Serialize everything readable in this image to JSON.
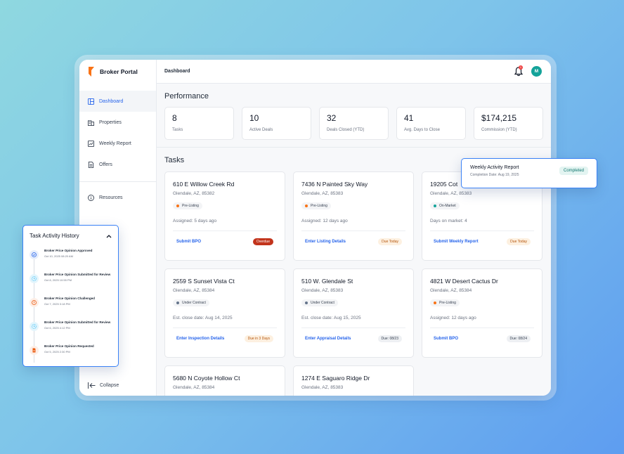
{
  "app": {
    "brand": "Broker Portal",
    "breadcrumb": "Dashboard",
    "notification_count": "1",
    "avatar_initial": "M"
  },
  "sidebar": {
    "items": [
      {
        "label": "Dashboard",
        "icon": "layout-icon"
      },
      {
        "label": "Properties",
        "icon": "building-icon"
      },
      {
        "label": "Weekly Report",
        "icon": "chart-icon"
      },
      {
        "label": "Offers",
        "icon": "document-icon"
      }
    ],
    "resources": "Resources",
    "collapse": "Collapse"
  },
  "performance": {
    "title": "Performance",
    "stats": [
      {
        "value": "8",
        "label": "Tasks"
      },
      {
        "value": "10",
        "label": "Active Deals"
      },
      {
        "value": "32",
        "label": "Deals Closed (YTD)"
      },
      {
        "value": "41",
        "label": "Avg. Days to Close"
      },
      {
        "value": "$174,215",
        "label": "Commission (YTD)"
      }
    ]
  },
  "tasks": {
    "title": "Tasks",
    "cards": [
      {
        "title": "610 E Willow Creek Rd",
        "address": "Glendale, AZ, 85382",
        "status": "Pre-Listing",
        "status_color": "#f97316",
        "meta": "Assigned: 5 days ago",
        "action": "Submit BPO",
        "badge": "Overdue",
        "badge_type": "overdue"
      },
      {
        "title": "7436 N Painted Sky Way",
        "address": "Glendale, AZ, 85383",
        "status": "Pre-Listing",
        "status_color": "#f97316",
        "meta": "Assigned: 12 days ago",
        "action": "Enter Listing Details",
        "badge": "Due Today",
        "badge_type": "due"
      },
      {
        "title": "19205 Cot",
        "address": "Glendale, AZ, 85383",
        "status": "On-Market",
        "status_color": "#14a39a",
        "meta": "Days on market: 4",
        "action": "Submit Weekly Report",
        "badge": "Due Today",
        "badge_type": "due"
      },
      {
        "title": "2559 S Sunset Vista Ct",
        "address": "Glendale, AZ, 85384",
        "status": "Under Contract",
        "status_color": "#64748b",
        "meta": "Est. close date: Aug 14, 2025",
        "action": "Enter Inspection Details",
        "badge": "Due in 3 Days",
        "badge_type": "due"
      },
      {
        "title": "510 W. Glendale St",
        "address": "Glendale, AZ, 85383",
        "status": "Under Contract",
        "status_color": "#64748b",
        "meta": "Est. close date: Aug 15, 2025",
        "action": "Enter Appraisal Details",
        "badge": "Due: 08/23",
        "badge_type": "neutral"
      },
      {
        "title": "4821 W Desert Cactus Dr",
        "address": "Glendale, AZ, 85384",
        "status": "Pre-Listing",
        "status_color": "#f97316",
        "meta": "Assigned: 12 days ago",
        "action": "Submit BPO",
        "badge": "Due: 08/24",
        "badge_type": "neutral"
      },
      {
        "title": "5680 N Coyote Hollow Ct",
        "address": "Glendale, AZ, 85384"
      },
      {
        "title": "1274 E Saguaro Ridge Dr",
        "address": "Glendale, AZ, 85383"
      }
    ]
  },
  "weekly_report": {
    "title": "Weekly Activity Report",
    "subtitle": "Completion Date: Aug 19, 2025",
    "badge": "Completed"
  },
  "history": {
    "title": "Task Activity History",
    "items": [
      {
        "text": "Broker Price Opinion Approved",
        "date": "Oct 10, 2025 08:20 AM",
        "icon": "check-circle-icon",
        "color": "#2563eb"
      },
      {
        "text": "Broker Price Opinion Submitted for Review",
        "date": "Oct 8, 2025 10:55 PM",
        "icon": "clock-icon",
        "color": "#38bdf8"
      },
      {
        "text": "Broker Price Opinion Challenged",
        "date": "Oct 7, 2025 3:18 PM",
        "icon": "alert-icon",
        "color": "#ea580c"
      },
      {
        "text": "Broker Price Opinion Submitted for Review",
        "date": "Oct 6, 2025 4:12 PM",
        "icon": "clock-icon",
        "color": "#38bdf8"
      },
      {
        "text": "Broker Price Opinion Requested",
        "date": "Oct 5, 2025 2:30 PM",
        "icon": "file-icon",
        "color": "#ea580c"
      }
    ]
  }
}
